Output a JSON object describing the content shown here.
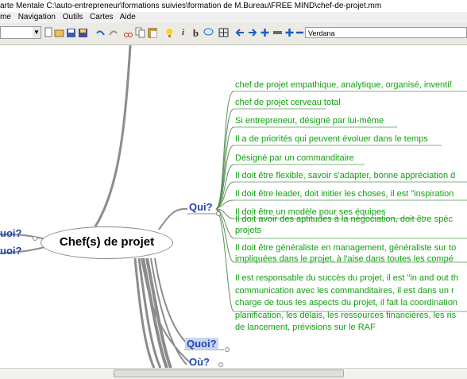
{
  "title_bar": {
    "title": "arte Mentale C:\\auto-entrepreneur\\formations suivies\\formation de M.Bureau\\FREE MIND\\chef-de-projet.mm"
  },
  "menu": {
    "items": [
      "me",
      "Navigation",
      "Outils",
      "Cartes",
      "Aide"
    ]
  },
  "toolbar": {
    "font_name": "Verdana",
    "italic_label": "i",
    "bold_label": "b"
  },
  "mindmap": {
    "central_node": "Chef(s) de projet",
    "left_branches": [
      "uoi?",
      "uoi?"
    ],
    "branches": {
      "qui": "Qui?",
      "quoi": "Quoi?",
      "ou": "Où?"
    },
    "qui_children": [
      "chef de projet empathique, analytique, organisé, inventif",
      "chef de projet cerveau total",
      "Si entrepreneur, désigné par lui-même",
      "Il a de priorités qui peuvent évoluer dans le temps",
      "Désigné par un commanditaire",
      "Il doit être flexible, savoir s'adapter, bonne appréciation d",
      "Il doit être leader, doit initier les choses, il est \"inspiration",
      "Il doit être un modèle pour ses équipes",
      [
        "Il doit avoir des aptitudes à la négociation, doit être spéc",
        "projets"
      ],
      [
        "Il doit être généraliste en management, généraliste sur to",
        "impliquées dans le projet, à l'aise dans toutes les compé"
      ],
      [
        "Il est responsable du succès du projet, il est \"in and out th",
        "communication avec les commanditaires, il est dans un r",
        "charge de tous les aspects du projet, il fait la coordination",
        "planification, les délais, les ressources financières, les ris",
        "de lancement, prévisions sur le RAF"
      ]
    ]
  },
  "colors": {
    "leaf_text": "#12a012",
    "branch_text": "#1f45b3",
    "edge": "#8c8c8c",
    "toolbar_bg": "#eceae4"
  }
}
